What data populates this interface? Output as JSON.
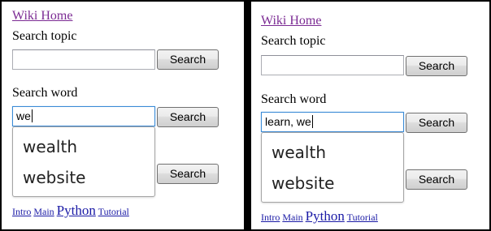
{
  "left": {
    "wiki_home": "Wiki Home",
    "topic_label": "Search topic",
    "topic_value": "",
    "topic_button": "Search",
    "word_label": "Search word",
    "word_value": "we",
    "word_button": "Search",
    "suggestions": [
      "wealth",
      "website"
    ],
    "third_button": "Search",
    "footer_links": [
      "Intro",
      "Main",
      "Python",
      "Tutorial"
    ]
  },
  "right": {
    "wiki_home": "Wiki Home",
    "topic_label": "Search topic",
    "topic_value": "",
    "topic_button": "Search",
    "word_label": "Search word",
    "word_value": "learn, we",
    "word_button": "Search",
    "suggestions": [
      "wealth",
      "website"
    ],
    "third_button": "Search",
    "footer_links": [
      "Intro",
      "Main",
      "Python",
      "Tutorial"
    ]
  },
  "colors": {
    "visited_link": "#7b2a93",
    "link": "#1a1aa6",
    "focus_border": "#3b8bd6"
  }
}
